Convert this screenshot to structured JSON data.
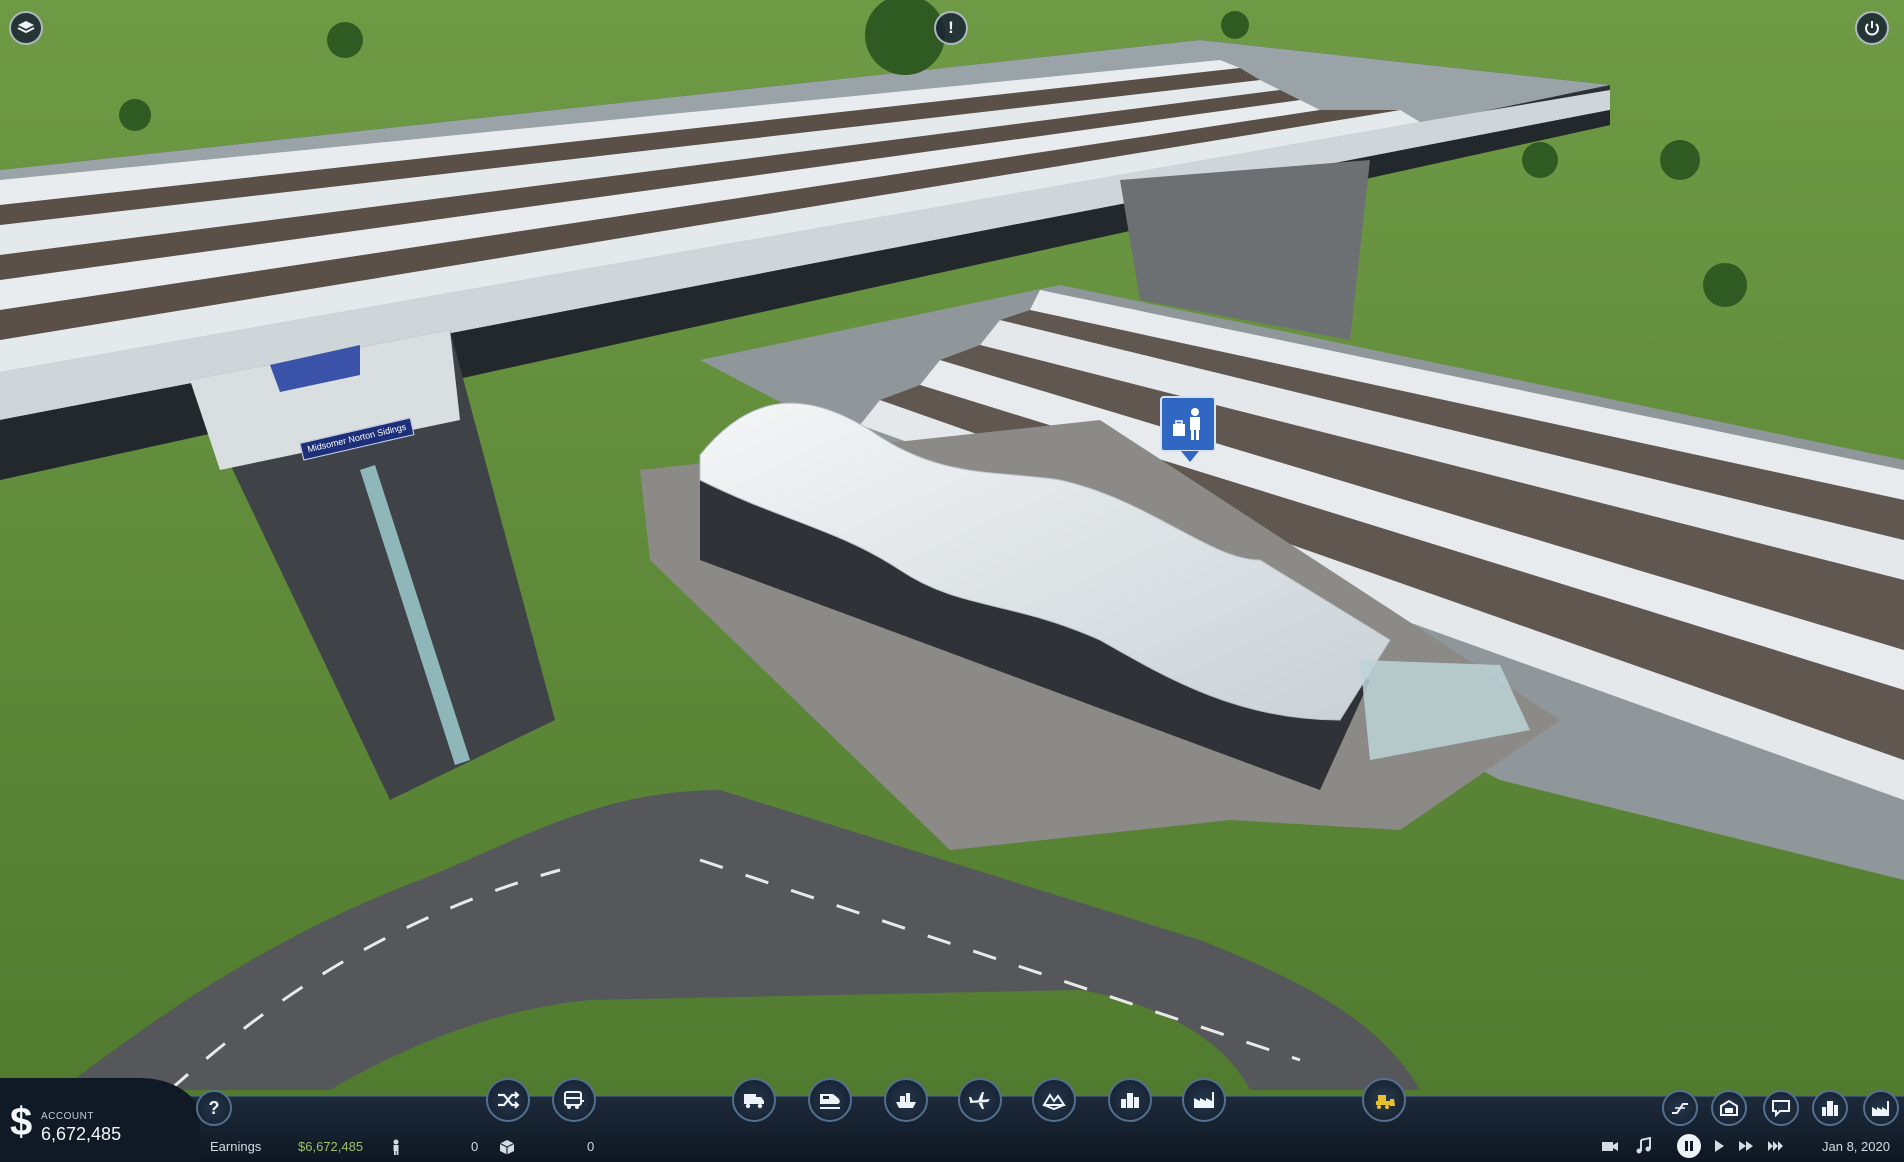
{
  "hud": {
    "top_left_icon": "layers-icon",
    "top_center_icon": "alert-icon",
    "top_center_label": "!",
    "top_right_icon": "power-icon"
  },
  "scene": {
    "station_sign": "Midsomer Norton Sidings",
    "station_marker_icon": "passenger-luggage-icon"
  },
  "account": {
    "label": "ACCOUNT",
    "value": "6,672,485",
    "currency_symbol": "$"
  },
  "status": {
    "earnings_label": "Earnings",
    "earnings_value": "$6,672,485",
    "passengers_value": "0",
    "cargo_value": "0",
    "date": "Jan 8, 2020"
  },
  "toolbar": {
    "help_label": "?",
    "items": [
      {
        "name": "lines",
        "icon": "shuffle-icon"
      },
      {
        "name": "vehicles",
        "icon": "bus-icon"
      },
      {
        "name": "road-vehicles",
        "icon": "truck-icon"
      },
      {
        "name": "trains",
        "icon": "train-icon"
      },
      {
        "name": "ships",
        "icon": "ship-icon"
      },
      {
        "name": "aircraft",
        "icon": "plane-icon"
      },
      {
        "name": "terrain",
        "icon": "terrain-icon"
      },
      {
        "name": "towns",
        "icon": "town-icon"
      },
      {
        "name": "industries",
        "icon": "factory-icon"
      },
      {
        "name": "bulldoze",
        "icon": "bulldozer-icon"
      }
    ],
    "right_items": [
      {
        "name": "lines-overview",
        "icon": "line-graph-icon"
      },
      {
        "name": "vehicle-overview",
        "icon": "depot-icon"
      },
      {
        "name": "messages",
        "icon": "message-icon"
      },
      {
        "name": "town-overview",
        "icon": "city-icon"
      },
      {
        "name": "industry-overview",
        "icon": "industry-icon"
      }
    ]
  },
  "colors": {
    "grass": "#5f8a3a",
    "ui_dark": "#101a26",
    "ui_border": "#54708f",
    "accent_gold": "#e8c22a",
    "marker_blue": "#2f67c2"
  }
}
